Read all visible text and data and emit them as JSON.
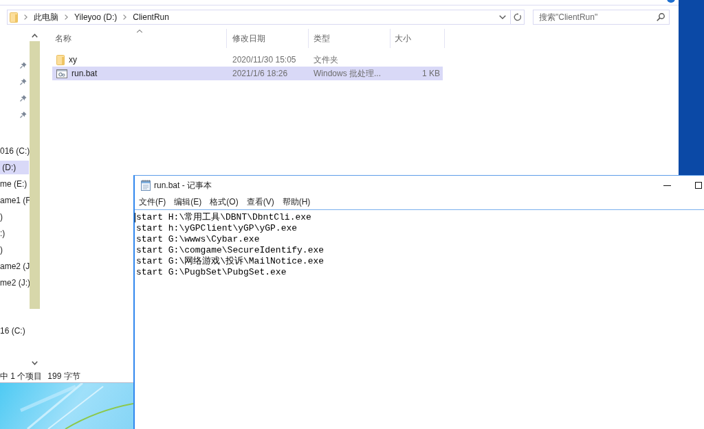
{
  "explorer": {
    "address_bar": {
      "path": [
        "此电脑",
        "Yileyoo (D:)",
        "ClientRun"
      ]
    },
    "search": {
      "placeholder": "搜索\"ClientRun\""
    },
    "sidebar": {
      "groups": [
        {
          "items": [
            {
              "kind": "pinned",
              "selected": false
            },
            {
              "kind": "pinned",
              "selected": false
            },
            {
              "kind": "pinned",
              "selected": false
            },
            {
              "kind": "pinned",
              "selected": false
            }
          ]
        },
        {
          "items": [
            {
              "kind": "drive",
              "label": "016 (C:)",
              "selected": false
            },
            {
              "kind": "drive",
              "label": " (D:)",
              "selected": true
            },
            {
              "kind": "drive",
              "label": "me (E:)",
              "selected": false
            },
            {
              "kind": "drive",
              "label": "ame1 (F",
              "selected": false
            },
            {
              "kind": "drive",
              "label": ")",
              "selected": false
            },
            {
              "kind": "drive",
              "label": ":)",
              "selected": false
            },
            {
              "kind": "drive",
              "label": ")",
              "selected": false
            },
            {
              "kind": "drive",
              "label": "ame2 (J",
              "selected": false
            },
            {
              "kind": "drive",
              "label": "me2 (J:)",
              "selected": false
            }
          ]
        },
        {
          "items": [
            {
              "kind": "drive",
              "label": "16 (C:)",
              "selected": false
            }
          ]
        }
      ]
    },
    "columns": [
      {
        "label": "名称",
        "sorted": true
      },
      {
        "label": "修改日期",
        "sorted": false
      },
      {
        "label": "类型",
        "sorted": false
      },
      {
        "label": "大小",
        "sorted": false
      }
    ],
    "files": [
      {
        "kind": "folder",
        "name": "xy",
        "modified": "2020/11/30 15:05",
        "type": "文件夹",
        "selected": false
      },
      {
        "kind": "batch",
        "name": "run.bat",
        "modified": "2021/1/6 18:26",
        "type": "Windows 批处理...",
        "size": "1 KB",
        "selected": true
      }
    ],
    "status_bar": {
      "selection": "中 1 个项目",
      "size": "199 字节"
    }
  },
  "notepad": {
    "title": "run.bat - 记事本",
    "menu": [
      "文件(F)",
      "编辑(E)",
      "格式(O)",
      "查看(V)",
      "帮助(H)"
    ],
    "lines": [
      "start H:\\常用工具\\DBNT\\DbntCli.exe",
      "start h:\\yGPClient\\yGP\\yGP.exe",
      "start G:\\wwws\\Cybar.exe",
      "start G:\\comgame\\SecureIdentify.exe",
      "start G:\\网络游戏\\投诉\\MailNotice.exe",
      "start G:\\PugbSet\\PubgSet.exe"
    ]
  }
}
